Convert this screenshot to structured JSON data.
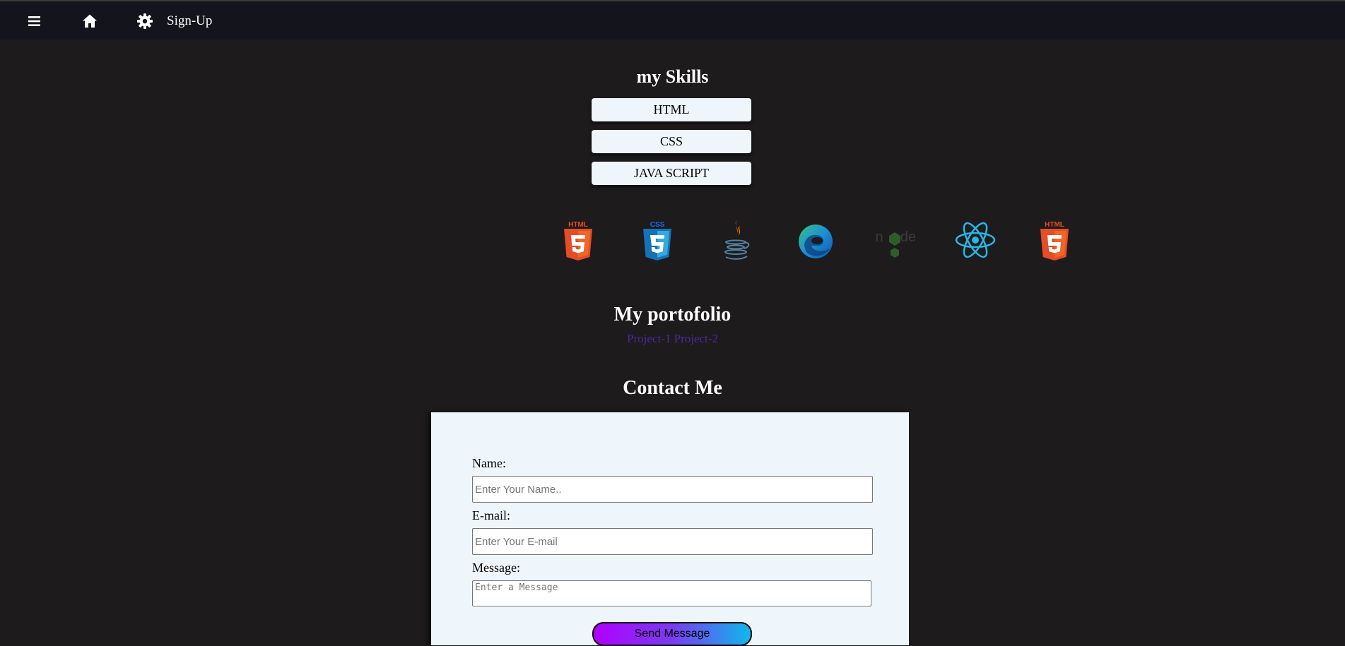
{
  "nav": {
    "menu_icon": "hamburger-menu-icon",
    "home_icon": "home-icon",
    "settings_icon": "gear-icon",
    "signup_label": "Sign-Up"
  },
  "skills": {
    "title": "my Skills",
    "items": [
      "HTML",
      "CSS",
      "JAVA SCRIPT"
    ]
  },
  "tech_icons": [
    "html5-icon",
    "css3-icon",
    "java-icon",
    "edge-icon",
    "nodejs-icon",
    "react-icon",
    "html5-icon"
  ],
  "portfolio": {
    "title": "My portofolio",
    "projects": [
      "Project-1",
      "Project-2"
    ]
  },
  "contact": {
    "title": "Contact Me",
    "name_label": "Name:",
    "name_placeholder": "Enter Your Name..",
    "email_label": "E-mail:",
    "email_placeholder": "Enter Your E-mail",
    "message_label": "Message:",
    "message_placeholder": "Enter a Message",
    "send_label": "Send Message"
  },
  "colors": {
    "background": "#1d1b1c",
    "topbar": "#14151c",
    "card": "#eef6fc",
    "link": "#4b2a9e"
  }
}
